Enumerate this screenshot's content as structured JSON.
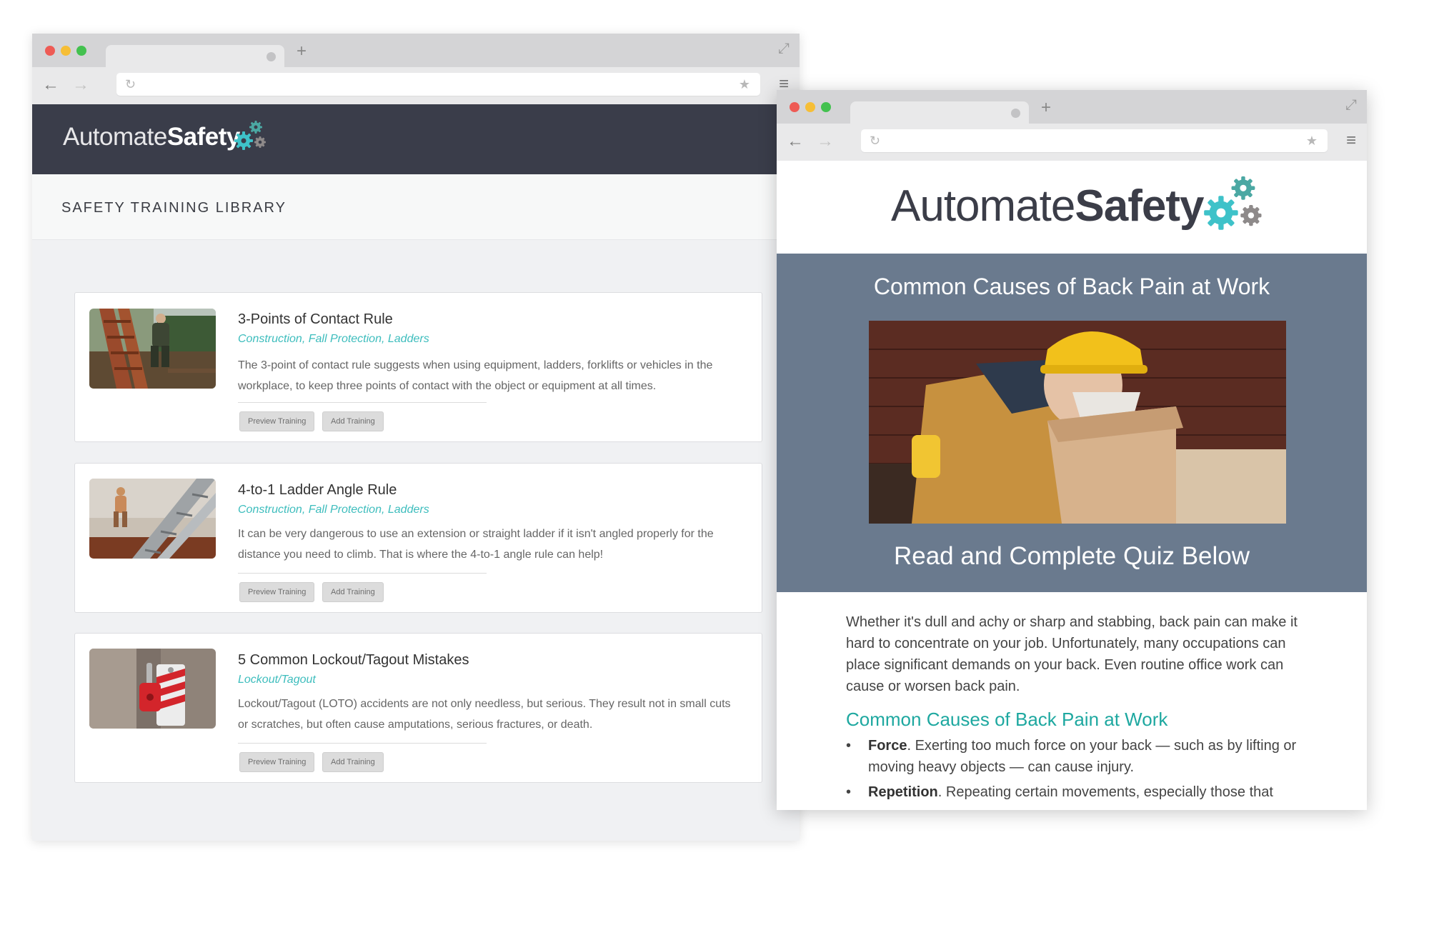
{
  "library_window": {
    "brand": {
      "part1": "Automate",
      "part2": "Safety"
    },
    "page_title": "SAFETY TRAINING LIBRARY",
    "trainings": [
      {
        "title": "3-Points of Contact Rule",
        "tags": "Construction, Fall Protection, Ladders",
        "description": "The 3-point of contact rule suggests when using equipment, ladders, forklifts or vehicles in the workplace, to keep three points of contact with the object or equipment at all times.",
        "preview_label": "Preview Training",
        "add_label": "Add Training"
      },
      {
        "title": "4-to-1 Ladder Angle Rule",
        "tags": "Construction, Fall Protection, Ladders",
        "description": "It can be very dangerous to use an extension or straight ladder if it isn't angled properly for the distance you need to climb.  That is where the 4-to-1 angle rule can help!",
        "preview_label": "Preview Training",
        "add_label": "Add Training"
      },
      {
        "title": "5 Common Lockout/Tagout Mistakes",
        "tags": "Lockout/Tagout",
        "description": "Lockout/Tagout (LOTO) accidents are not only needless, but serious.  They result not in small cuts or scratches, but often cause amputations, serious fractures, or death.",
        "preview_label": "Preview Training",
        "add_label": "Add Training"
      }
    ]
  },
  "article_window": {
    "brand": {
      "part1": "Automate",
      "part2": "Safety"
    },
    "hero_title": "Common Causes of Back Pain at Work",
    "hero_subtitle": "Read and Complete Quiz Below",
    "intro": "Whether it's dull and achy or sharp and stabbing, back pain can make it hard to concentrate on your job. Unfortunately, many occupations can place significant demands on your back. Even routine office work can cause or worsen back pain.",
    "section_title": "Common Causes of Back Pain at Work",
    "bullets": [
      {
        "term": "Force",
        "text": ". Exerting too much force on your back — such as by lifting or moving heavy objects — can cause injury."
      },
      {
        "term": "Repetition",
        "text": ". Repeating certain movements, especially those that"
      }
    ]
  },
  "icons": {
    "back": "arrow-left-icon",
    "forward": "arrow-right-icon",
    "reload": "reload-icon",
    "bookmark": "star-icon",
    "menu": "hamburger-icon",
    "new_tab": "plus-icon",
    "fullscreen": "expand-icon",
    "logo_gears": "gears-icon"
  },
  "colors": {
    "header_dark": "#3a3d4a",
    "teal_accent": "#3dbdbd",
    "hero_slate": "#6a7a8e",
    "section_teal": "#1ea8a0"
  }
}
